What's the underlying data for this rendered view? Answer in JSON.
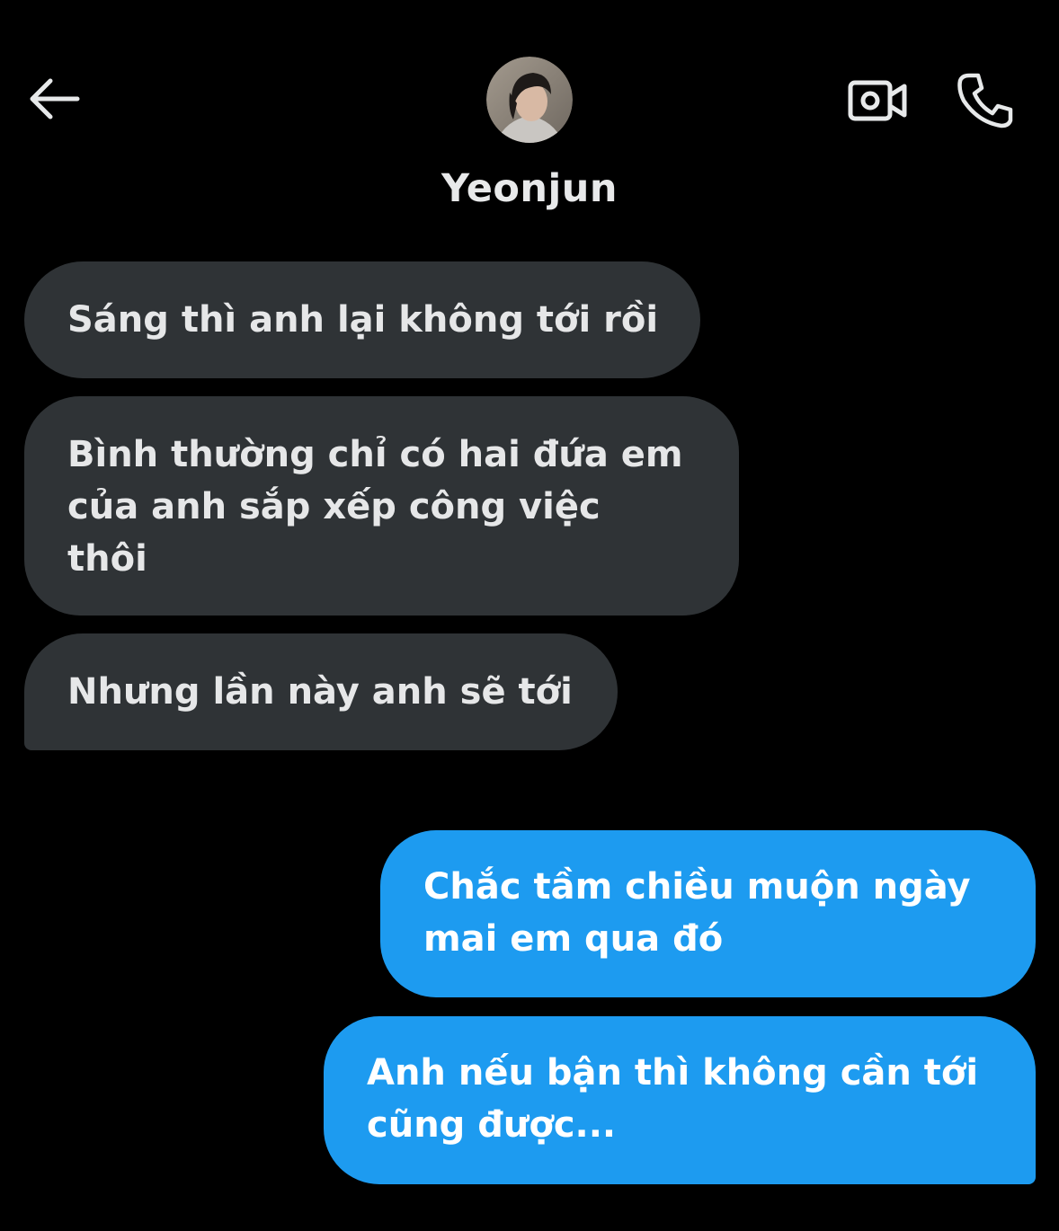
{
  "header": {
    "contact_name": "Yeonjun",
    "back_icon": "arrow-left-icon",
    "video_icon": "video-camera-icon",
    "call_icon": "phone-icon"
  },
  "colors": {
    "background": "#000000",
    "received_bubble": "#2f3336",
    "sent_bubble": "#1d9bf0",
    "text": "#e7e9ea"
  },
  "messages": [
    {
      "direction": "received",
      "lines": [
        "Sáng thì anh lại không tới rồi"
      ]
    },
    {
      "direction": "received",
      "lines": [
        "Bình thường chỉ có hai đứa em",
        "của anh sắp xếp công việc",
        "thôi"
      ]
    },
    {
      "direction": "received",
      "lines": [
        "Nhưng lần này anh sẽ tới"
      ]
    },
    {
      "direction": "sent",
      "lines": [
        "Chắc tầm chiều muộn ngày",
        "mai em qua đó"
      ]
    },
    {
      "direction": "sent",
      "lines": [
        "Anh nếu bận thì không cần tới",
        "cũng được..."
      ]
    }
  ]
}
